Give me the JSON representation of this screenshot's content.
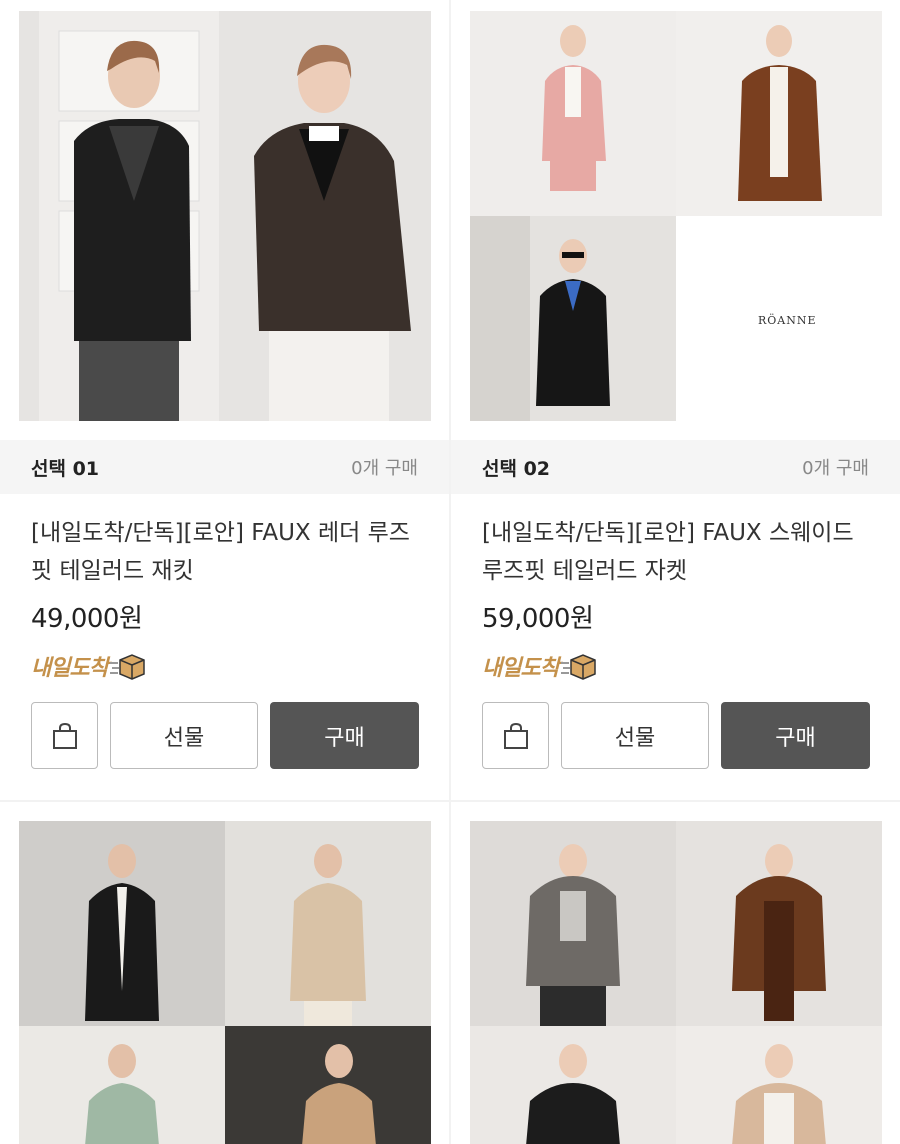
{
  "products": [
    {
      "select_label": "선택 01",
      "count_label": "0개 구매",
      "name": "[내일도착/단독][로안] FAUX 레더 루즈핏 테일러드 재킷",
      "price": "49,000원",
      "badge": "내일도착",
      "gift_label": "선물",
      "buy_label": "구매"
    },
    {
      "select_label": "선택 02",
      "count_label": "0개 구매",
      "name": "[내일도착/단독][로안] FAUX 스웨이드 루즈핏 테일러드 자켓",
      "price": "59,000원",
      "badge": "내일도착",
      "gift_label": "선물",
      "buy_label": "구매",
      "brand_logo": "RÖANNE"
    }
  ],
  "icons": {
    "cart": "shopping-bag-icon",
    "badge": "delivery-box-icon"
  },
  "colors": {
    "badge": "#c4914b",
    "buy_button": "#555555",
    "select_bar": "#f5f5f5"
  }
}
